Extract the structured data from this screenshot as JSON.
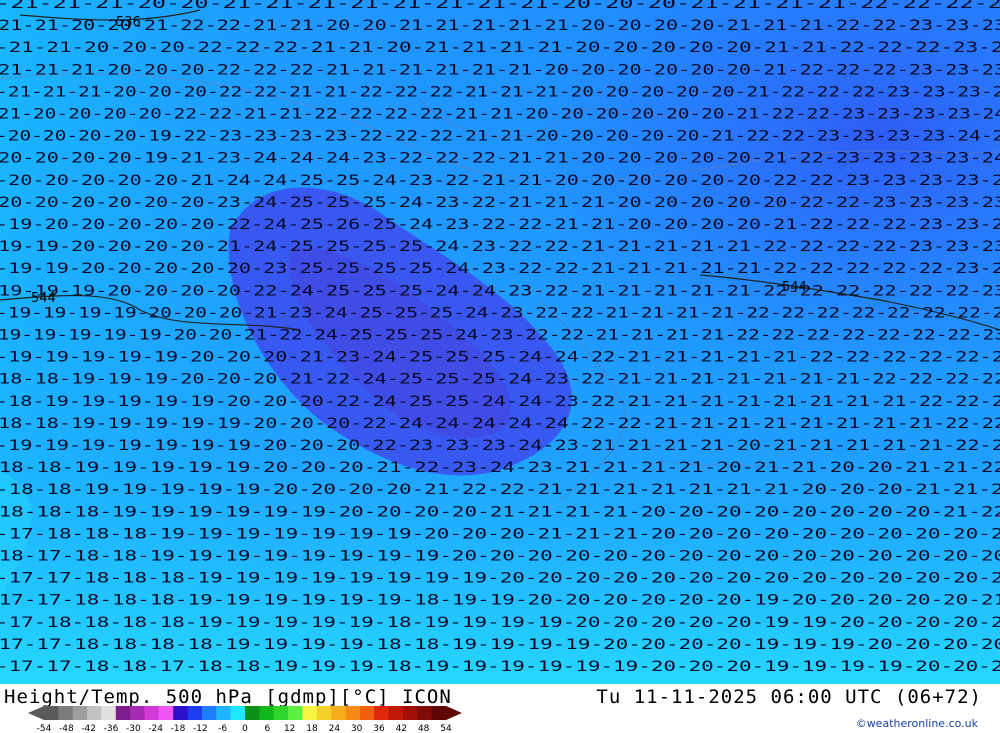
{
  "map": {
    "background_colors": [
      "#1fa0ff",
      "#1f82ff",
      "#2b63ff",
      "#3d4ff0",
      "#19c8ff",
      "#2ef0ff"
    ],
    "contour_color": "#000000",
    "isoline_labels": [
      "536",
      "544",
      "544"
    ],
    "temperature_rows": [
      "-21-21-21-20-20-21-21-21-21-21-21-21-21-20-20-20-21-21-21-21-22-22-22-22",
      "-21-21-20-20-21-22-22-21-21-20-20-21-21-21-21-21-20-20-20-20-21-21-21-22-22-23-23-23",
      "-21-21-20-20-20-22-22-22-21-21-20-21-21-21-21-20-20-20-20-20-21-21-22-22-22-23-23",
      "-21-21-21-20-20-20-22-22-22-21-21-21-21-21-21-20-20-20-20-20-20-21-22-22-22-23-23-23",
      "-21-21-21-20-20-20-22-22-21-21-22-22-22-21-21-21-20-20-20-20-20-21-22-22-22-23-23-23-24",
      "-21-20-20-20-20-22-22-21-21-22-22-22-22-21-21-20-20-20-20-20-20-21-22-22-23-23-23-23-24",
      "-20-20-20-20-19-22-23-23-23-23-22-22-22-21-21-20-20-20-20-20-21-22-22-23-23-23-23-24-24",
      "-20-20-20-20-19-21-23-24-24-24-23-22-22-22-21-21-20-20-20-20-20-21-22-23-23-23-23-24",
      "-20-20-20-20-20-21-24-24-25-25-24-23-22-21-21-20-20-20-20-20-20-22-22-23-23-23-23-23",
      "-20-20-20-20-20-20-23-24-25-25-25-24-23-22-21-21-21-20-20-20-20-20-22-22-23-23-23-23",
      "-19-20-20-20-20-20-22-24-25-26-25-24-23-22-22-21-21-20-20-20-20-21-22-22-22-23-23-23",
      "-19-19-20-20-20-20-21-24-25-25-25-25-24-23-22-22-21-21-21-21-21-22-22-22-22-23-23-23",
      "-19-19-20-20-20-20-20-23-25-25-25-25-24-23-22-22-21-21-21-21-21-22-22-22-22-22-23-23",
      "-19-19-19-20-20-20-20-22-24-25-25-25-24-24-23-22-21-21-21-21-21-22-22-22-22-22-22-23",
      "-19-19-19-19-20-20-20-21-23-24-25-25-25-24-23-22-22-21-21-21-21-22-22-22-22-22-22-22-23",
      "-19-19-19-19-19-20-20-21-22-24-25-25-25-24-23-22-22-21-21-21-21-22-22-22-22-22-22-22-23",
      "-19-19-19-19-19-20-20-20-21-23-24-25-25-25-24-24-22-21-21-21-21-21-22-22-22-22-22-22",
      "-18-18-19-19-19-20-20-20-21-22-24-25-25-25-24-23-22-21-21-21-21-21-21-21-22-22-22-22",
      "-18-19-19-19-19-19-20-20-20-22-24-25-25-24-24-23-22-21-21-21-21-21-21-21-21-22-22-22",
      "-18-18-19-19-19-19-19-20-20-20-22-24-24-24-24-24-22-22-21-21-21-21-21-21-21-21-22-22",
      "-19-19-19-19-19-19-19-20-20-20-22-23-23-23-24-23-21-21-21-21-20-21-21-21-21-21-22-22",
      "-18-18-19-19-19-19-19-20-20-20-21-22-23-24-23-21-21-21-21-20-21-21-20-20-21-21-22",
      "-18-18-19-19-19-19-19-20-20-20-20-21-22-22-21-21-21-21-21-21-21-20-20-20-21-21-22",
      "-18-18-18-19-19-19-19-19-19-20-20-20-20-21-21-21-21-20-20-20-20-20-20-20-20-21-22",
      "-17-18-18-18-19-19-19-19-19-19-19-20-20-20-21-21-21-20-20-20-20-20-20-20-20-20-21",
      "-18-17-18-18-19-19-19-19-19-19-19-19-20-20-20-20-20-20-20-20-20-20-20-20-20-20-20",
      "-17-17-18-18-18-19-19-19-19-19-19-19-19-20-20-20-20-20-20-20-20-20-20-20-20-20-21",
      "-17-17-18-18-18-19-19-19-19-19-19-18-19-19-20-20-20-20-20-20-19-20-20-20-20-20-21",
      "-17-18-18-18-18-19-19-19-19-19-18-19-19-19-19-20-20-20-20-20-19-19-20-20-20-20-20",
      "-17-17-18-18-18-18-19-19-19-19-18-18-19-19-19-19-20-20-20-20-19-19-19-20-20-20-20",
      "-17-17-18-18-17-18-18-19-19-19-18-19-19-19-19-19-19-20-20-20-19-19-19-19-20-20-20"
    ]
  },
  "footer": {
    "title": "Height/Temp. 500 hPa [gdmp][°C] ICON",
    "datetime": "Tu 11-11-2025 06:00 UTC (06+72)",
    "credit": "©weatheronline.co.uk",
    "colorbar": {
      "ticks": [
        "-54",
        "-48",
        "-42",
        "-36",
        "-30",
        "-24",
        "-18",
        "-12",
        "-6",
        "0",
        "6",
        "12",
        "18",
        "24",
        "30",
        "36",
        "42",
        "48",
        "54"
      ],
      "colors": [
        "#5a5a5a",
        "#7c7c7c",
        "#9e9e9e",
        "#c2c2c2",
        "#e0e0e0",
        "#7d1c8c",
        "#a72ab5",
        "#d23ad8",
        "#f055f5",
        "#2a10c8",
        "#1d3df0",
        "#1e7cff",
        "#1eb3ff",
        "#1ee8ff",
        "#0b8f14",
        "#12b81b",
        "#2fd52b",
        "#5cf042",
        "#f5f542",
        "#f5d22a",
        "#f5ae1c",
        "#f58a14",
        "#f56010",
        "#e0280c",
        "#c0180a",
        "#a01008",
        "#800a06",
        "#600404"
      ]
    }
  }
}
